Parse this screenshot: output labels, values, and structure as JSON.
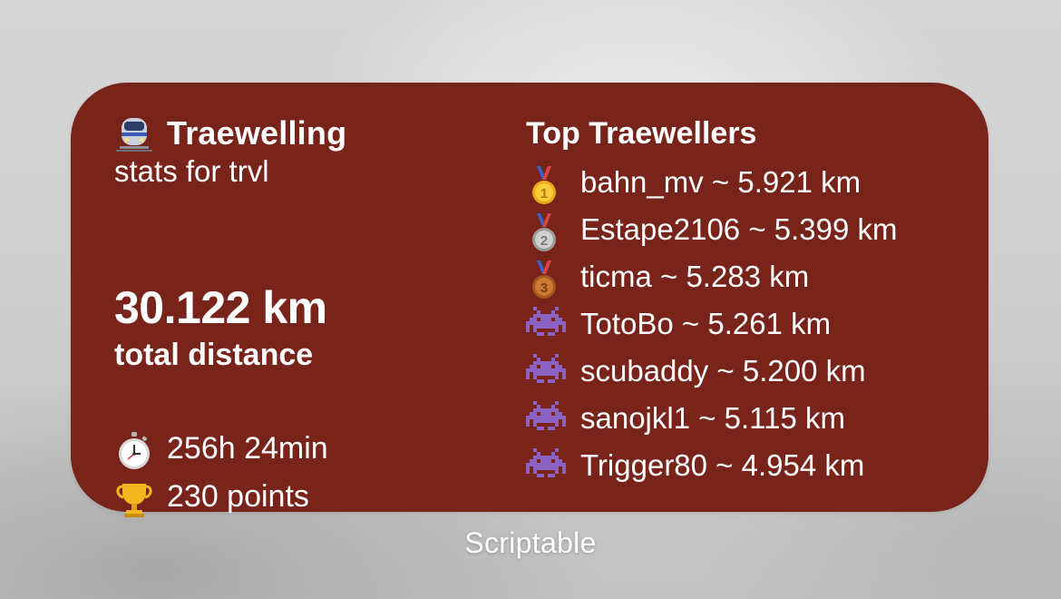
{
  "widget": {
    "title": "Traewelling",
    "title_icon": "train-icon",
    "subtitle": "stats for trvl",
    "total_distance": "30.122 km",
    "total_distance_label": "total distance",
    "duration": "256h 24min",
    "duration_icon": "stopwatch-icon",
    "points": "230 points",
    "points_icon": "trophy-icon",
    "background_color": "#78241a"
  },
  "leaderboard": {
    "title": "Top Traewellers",
    "entries": [
      {
        "icon": "gold-medal-icon",
        "text": "bahn_mv ~ 5.921 km"
      },
      {
        "icon": "silver-medal-icon",
        "text": "Estape2106 ~ 5.399 km"
      },
      {
        "icon": "bronze-medal-icon",
        "text": "ticma ~ 5.283 km"
      },
      {
        "icon": "space-invader-icon",
        "text": "TotoBo ~ 5.261 km"
      },
      {
        "icon": "space-invader-icon",
        "text": "scubaddy ~ 5.200 km"
      },
      {
        "icon": "space-invader-icon",
        "text": "sanojkl1 ~ 5.115 km"
      },
      {
        "icon": "space-invader-icon",
        "text": "Trigger80 ~ 4.954 km"
      }
    ]
  },
  "caption": "Scriptable"
}
